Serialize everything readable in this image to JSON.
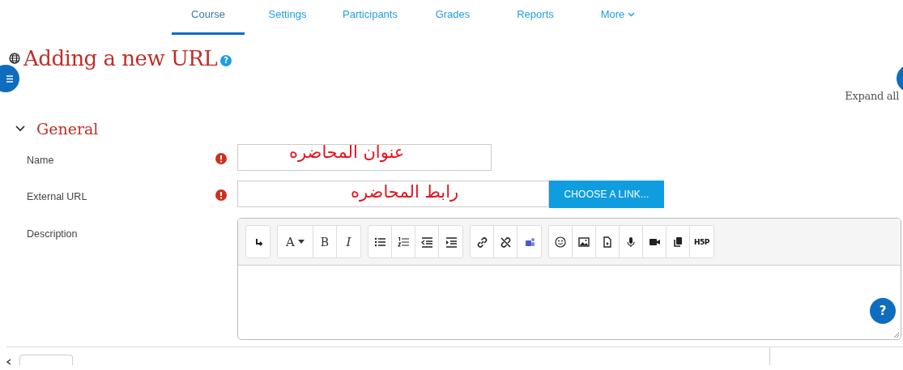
{
  "tabs": [
    {
      "label": "Course",
      "selected": true
    },
    {
      "label": "Settings",
      "selected": false
    },
    {
      "label": "Participants",
      "selected": false
    },
    {
      "label": "Grades",
      "selected": false
    },
    {
      "label": "Reports",
      "selected": false
    },
    {
      "label": "More",
      "selected": false,
      "dropdown": true
    }
  ],
  "page_title": "Adding a new URL",
  "page_help": "?",
  "expand_all": "Expand all",
  "section": {
    "title": "General",
    "expanded": true
  },
  "fields": [
    {
      "kind": "text",
      "label": "Name",
      "required": true,
      "annotation": "عنوان المحاضره"
    },
    {
      "kind": "url",
      "label": "External URL",
      "required": true,
      "button": "CHOOSE A LINK...",
      "annotation": "رابط المحاضره"
    },
    {
      "kind": "editor",
      "label": "Description",
      "required": false,
      "help": "?",
      "toolbar": [
        [
          {
            "kind": "redo"
          }
        ],
        [
          {
            "kind": "font",
            "label": "A"
          },
          {
            "kind": "bold",
            "label": "B"
          },
          {
            "kind": "italic",
            "label": "I"
          }
        ],
        [
          {
            "kind": "bullets"
          },
          {
            "kind": "numbers"
          },
          {
            "kind": "outdent"
          },
          {
            "kind": "indent"
          }
        ],
        [
          {
            "kind": "link"
          },
          {
            "kind": "unlink"
          },
          {
            "kind": "teams"
          }
        ],
        [
          {
            "kind": "emoji"
          },
          {
            "kind": "image"
          },
          {
            "kind": "media"
          },
          {
            "kind": "mic"
          },
          {
            "kind": "video"
          },
          {
            "kind": "copy"
          },
          {
            "kind": "h5p",
            "label": "H5P"
          }
        ]
      ]
    }
  ]
}
